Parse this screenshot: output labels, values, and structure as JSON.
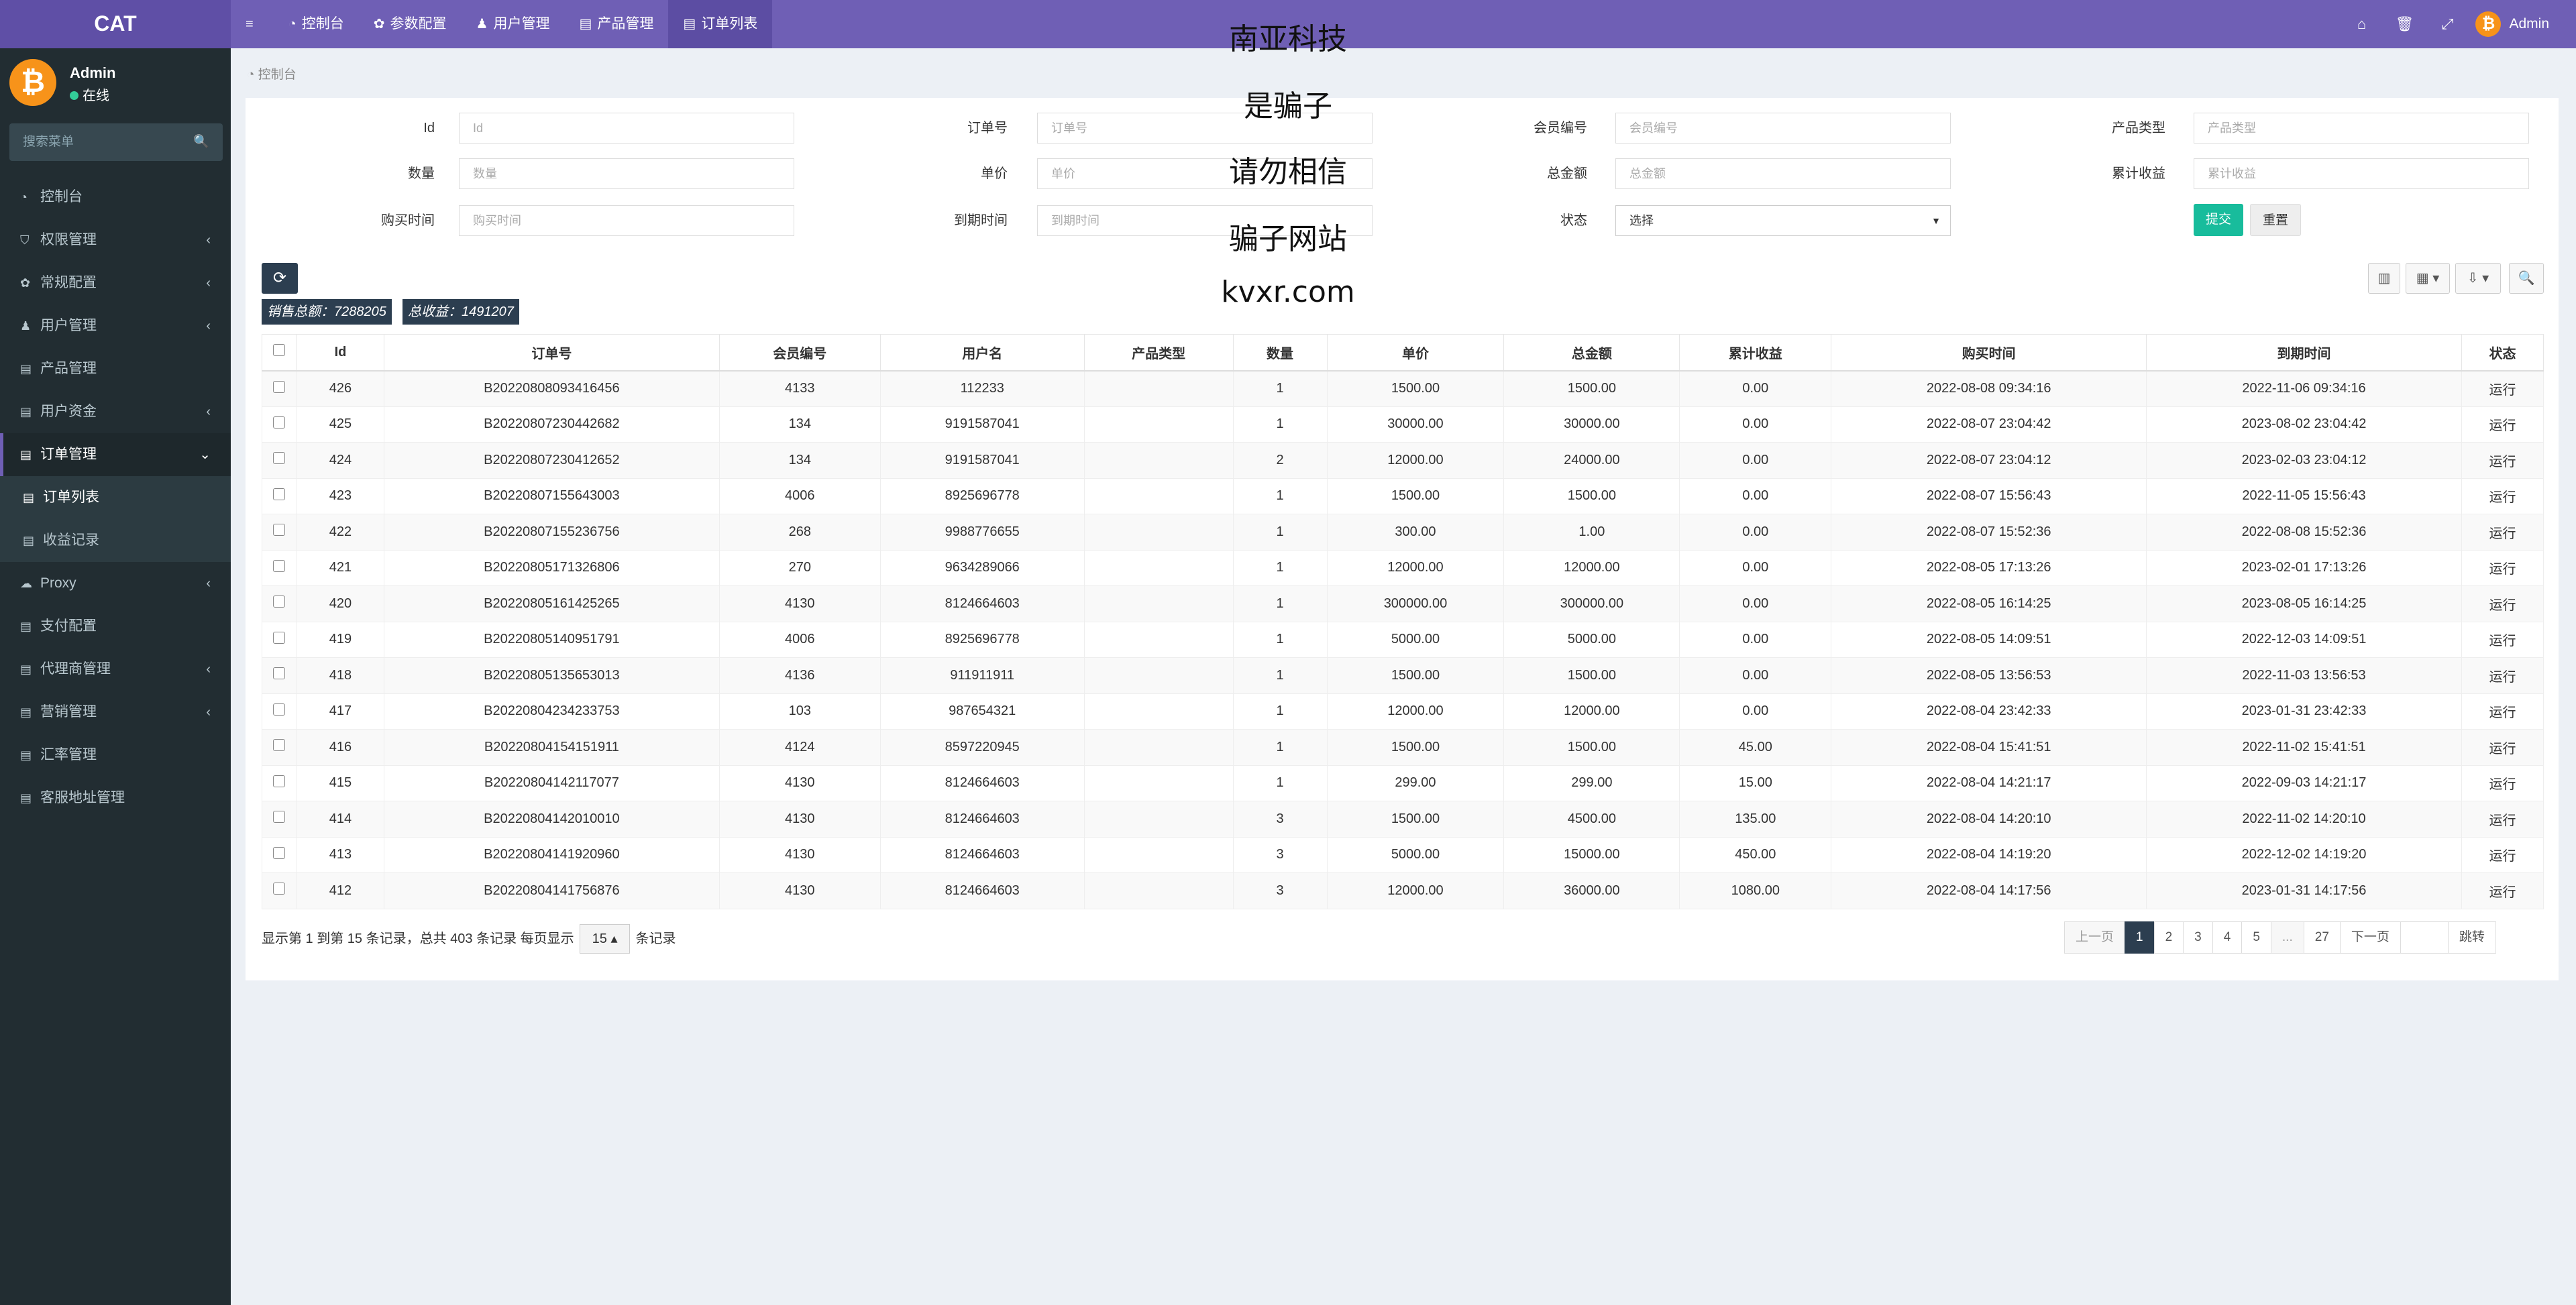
{
  "app": {
    "logo": "CAT"
  },
  "topnav": [
    {
      "icon": "≡",
      "label": ""
    },
    {
      "icon": "◔",
      "label": "控制台"
    },
    {
      "icon": "✿",
      "label": "参数配置"
    },
    {
      "icon": "♟",
      "label": "用户管理"
    },
    {
      "icon": "▤",
      "label": "产品管理"
    },
    {
      "icon": "▤",
      "label": "订单列表"
    }
  ],
  "topright": {
    "home_icon": "⌂",
    "trash_icon": "🗑",
    "fullscreen_icon": "⤢",
    "avatar_glyph": "₿",
    "username": "Admin"
  },
  "profile": {
    "name": "Admin",
    "status": "在线",
    "avatar_glyph": "₿"
  },
  "sidebar_search": {
    "placeholder": "搜索菜单",
    "icon": "🔍"
  },
  "menu": [
    {
      "icon": "◔",
      "label": "控制台",
      "arrow": ""
    },
    {
      "icon": "⛉",
      "label": "权限管理",
      "arrow": "‹"
    },
    {
      "icon": "✿",
      "label": "常规配置",
      "arrow": "‹"
    },
    {
      "icon": "♟",
      "label": "用户管理",
      "arrow": "‹"
    },
    {
      "icon": "▤",
      "label": "产品管理",
      "arrow": ""
    },
    {
      "icon": "▤",
      "label": "用户资金",
      "arrow": "‹"
    },
    {
      "icon": "▤",
      "label": "订单管理",
      "arrow": "⌄"
    },
    {
      "icon": "▤",
      "label": "订单列表",
      "arrow": ""
    },
    {
      "icon": "▤",
      "label": "收益记录",
      "arrow": ""
    },
    {
      "icon": "☁",
      "label": "Proxy",
      "arrow": "‹"
    },
    {
      "icon": "▤",
      "label": "支付配置",
      "arrow": ""
    },
    {
      "icon": "▤",
      "label": "代理商管理",
      "arrow": "‹"
    },
    {
      "icon": "▤",
      "label": "营销管理",
      "arrow": "‹"
    },
    {
      "icon": "▤",
      "label": "汇率管理",
      "arrow": ""
    },
    {
      "icon": "▤",
      "label": "客服地址管理",
      "arrow": ""
    }
  ],
  "breadcrumb": {
    "icon": "◔",
    "label": "控制台"
  },
  "filters": {
    "id": {
      "label": "Id",
      "placeholder": "Id"
    },
    "order_no": {
      "label": "订单号",
      "placeholder": "订单号"
    },
    "member_no": {
      "label": "会员编号",
      "placeholder": "会员编号"
    },
    "product_type": {
      "label": "产品类型",
      "placeholder": "产品类型"
    },
    "qty": {
      "label": "数量",
      "placeholder": "数量"
    },
    "price": {
      "label": "单价",
      "placeholder": "单价"
    },
    "total": {
      "label": "总金额",
      "placeholder": "总金额"
    },
    "earnings": {
      "label": "累计收益",
      "placeholder": "累计收益"
    },
    "buy_time": {
      "label": "购买时间",
      "placeholder": "购买时间"
    },
    "expire_time": {
      "label": "到期时间",
      "placeholder": "到期时间"
    },
    "status": {
      "label": "状态",
      "value": "选择"
    },
    "submit": "提交",
    "reset": "重置"
  },
  "toolbar": {
    "refresh_icon": "⟳",
    "columns_icon": "▥",
    "export_icon": "▦ ▾",
    "toggle_icon": "⇩ ▾",
    "search_icon": "🔍"
  },
  "summary": {
    "sales": "销售总额：7288205",
    "earnings": "总收益：1491207"
  },
  "table": {
    "headers": [
      "Id",
      "订单号",
      "会员编号",
      "用户名",
      "产品类型",
      "数量",
      "单价",
      "总金额",
      "累计收益",
      "购买时间",
      "到期时间",
      "状态"
    ],
    "rows": [
      [
        "426",
        "B20220808093416456",
        "4133",
        "112233",
        "",
        "1",
        "1500.00",
        "1500.00",
        "0.00",
        "2022-08-08 09:34:16",
        "2022-11-06 09:34:16",
        "运行"
      ],
      [
        "425",
        "B20220807230442682",
        "134",
        "9191587041",
        "",
        "1",
        "30000.00",
        "30000.00",
        "0.00",
        "2022-08-07 23:04:42",
        "2023-08-02 23:04:42",
        "运行"
      ],
      [
        "424",
        "B20220807230412652",
        "134",
        "9191587041",
        "",
        "2",
        "12000.00",
        "24000.00",
        "0.00",
        "2022-08-07 23:04:12",
        "2023-02-03 23:04:12",
        "运行"
      ],
      [
        "423",
        "B20220807155643003",
        "4006",
        "8925696778",
        "",
        "1",
        "1500.00",
        "1500.00",
        "0.00",
        "2022-08-07 15:56:43",
        "2022-11-05 15:56:43",
        "运行"
      ],
      [
        "422",
        "B20220807155236756",
        "268",
        "9988776655",
        "",
        "1",
        "300.00",
        "1.00",
        "0.00",
        "2022-08-07 15:52:36",
        "2022-08-08 15:52:36",
        "运行"
      ],
      [
        "421",
        "B20220805171326806",
        "270",
        "9634289066",
        "",
        "1",
        "12000.00",
        "12000.00",
        "0.00",
        "2022-08-05 17:13:26",
        "2023-02-01 17:13:26",
        "运行"
      ],
      [
        "420",
        "B20220805161425265",
        "4130",
        "8124664603",
        "",
        "1",
        "300000.00",
        "300000.00",
        "0.00",
        "2022-08-05 16:14:25",
        "2023-08-05 16:14:25",
        "运行"
      ],
      [
        "419",
        "B20220805140951791",
        "4006",
        "8925696778",
        "",
        "1",
        "5000.00",
        "5000.00",
        "0.00",
        "2022-08-05 14:09:51",
        "2022-12-03 14:09:51",
        "运行"
      ],
      [
        "418",
        "B20220805135653013",
        "4136",
        "911911911",
        "",
        "1",
        "1500.00",
        "1500.00",
        "0.00",
        "2022-08-05 13:56:53",
        "2022-11-03 13:56:53",
        "运行"
      ],
      [
        "417",
        "B20220804234233753",
        "103",
        "987654321",
        "",
        "1",
        "12000.00",
        "12000.00",
        "0.00",
        "2022-08-04 23:42:33",
        "2023-01-31 23:42:33",
        "运行"
      ],
      [
        "416",
        "B20220804154151911",
        "4124",
        "8597220945",
        "",
        "1",
        "1500.00",
        "1500.00",
        "45.00",
        "2022-08-04 15:41:51",
        "2022-11-02 15:41:51",
        "运行"
      ],
      [
        "415",
        "B20220804142117077",
        "4130",
        "8124664603",
        "",
        "1",
        "299.00",
        "299.00",
        "15.00",
        "2022-08-04 14:21:17",
        "2022-09-03 14:21:17",
        "运行"
      ],
      [
        "414",
        "B20220804142010010",
        "4130",
        "8124664603",
        "",
        "3",
        "1500.00",
        "4500.00",
        "135.00",
        "2022-08-04 14:20:10",
        "2022-11-02 14:20:10",
        "运行"
      ],
      [
        "413",
        "B20220804141920960",
        "4130",
        "8124664603",
        "",
        "3",
        "5000.00",
        "15000.00",
        "450.00",
        "2022-08-04 14:19:20",
        "2022-12-02 14:19:20",
        "运行"
      ],
      [
        "412",
        "B20220804141756876",
        "4130",
        "8124664603",
        "",
        "3",
        "12000.00",
        "36000.00",
        "1080.00",
        "2022-08-04 14:17:56",
        "2023-01-31 14:17:56",
        "运行"
      ]
    ]
  },
  "pagination_info": {
    "before": "显示第 1 到第 15 条记录，总共 403 条记录 每页显示",
    "page_size": "15 ▴",
    "after": "条记录"
  },
  "pager": {
    "prev": "上一页",
    "pages": [
      "1",
      "2",
      "3",
      "4",
      "5",
      "...",
      "27"
    ],
    "next": "下一页",
    "jump": "跳转"
  },
  "watermark": [
    "南亚科技",
    "是骗子",
    "请勿相信",
    "骗子网站",
    "kvxr.com"
  ]
}
